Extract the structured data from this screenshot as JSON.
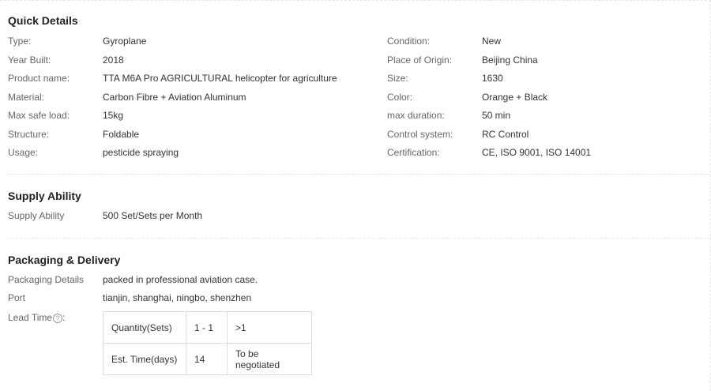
{
  "quick_details": {
    "title": "Quick Details",
    "left": [
      {
        "label": "Type:",
        "value": "Gyroplane"
      },
      {
        "label": "Year Built:",
        "value": "2018"
      },
      {
        "label": "Product name:",
        "value": "TTA M6A Pro AGRICULTURAL helicopter for agriculture"
      },
      {
        "label": "Material:",
        "value": "Carbon Fibre + Aviation Aluminum"
      },
      {
        "label": "Max safe load:",
        "value": "15kg"
      },
      {
        "label": "Structure:",
        "value": "Foldable"
      },
      {
        "label": "Usage:",
        "value": "pesticide spraying"
      }
    ],
    "right": [
      {
        "label": "Condition:",
        "value": "New"
      },
      {
        "label": "Place of Origin:",
        "value": "Beijing China"
      },
      {
        "label": "Size:",
        "value": "1630"
      },
      {
        "label": "Color:",
        "value": "Orange + Black"
      },
      {
        "label": "max duration:",
        "value": "50 min"
      },
      {
        "label": "Control system:",
        "value": "RC Control"
      },
      {
        "label": "Certification:",
        "value": "CE, ISO 9001, ISO 14001"
      }
    ]
  },
  "supply": {
    "title": "Supply Ability",
    "label": "Supply Ability",
    "value": "500 Set/Sets per Month"
  },
  "packaging": {
    "title": "Packaging & Delivery",
    "details_label": "Packaging Details",
    "details_value": "packed in professional aviation case.",
    "port_label": "Port",
    "port_value": "tianjin, shanghai, ningbo, shenzhen",
    "lead_label": "Lead Time",
    "help_glyph": "?",
    "lead_table": [
      [
        "Quantity(Sets)",
        "1 - 1",
        ">1"
      ],
      [
        "Est. Time(days)",
        "14",
        "To be negotiated"
      ]
    ]
  }
}
